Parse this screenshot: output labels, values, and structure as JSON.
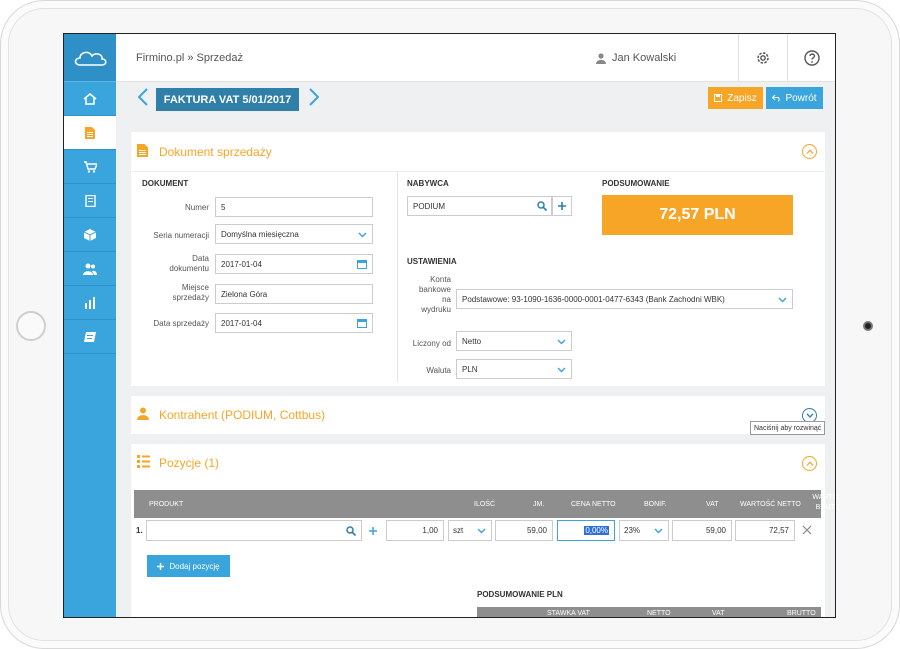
{
  "topbar": {
    "breadcrumb": "Firmino.pl » Sprzedaż",
    "user_name": "Jan Kowalski"
  },
  "titlebar": {
    "document_title": "FAKTURA VAT 5/01/2017",
    "save_label": "Zapisz",
    "back_label": "Powrót"
  },
  "sidebar": {
    "items": [
      {
        "icon": "home-icon"
      },
      {
        "icon": "document-icon",
        "active": true
      },
      {
        "icon": "cart-icon"
      },
      {
        "icon": "book-icon"
      },
      {
        "icon": "box-icon"
      },
      {
        "icon": "users-icon"
      },
      {
        "icon": "chart-icon"
      },
      {
        "icon": "notebook-icon"
      }
    ]
  },
  "document_section": {
    "title": "Dokument sprzedaży",
    "dokument": {
      "label": "DOKUMENT",
      "numer_label": "Numer",
      "numer_value": "5",
      "seria_label": "Seria numeracji",
      "seria_value": "Domyślna miesięczna",
      "data_dok_label_1": "Data",
      "data_dok_label_2": "dokumentu",
      "data_dok_value": "2017-01-04",
      "miejsce_label_1": "Miejsce",
      "miejsce_label_2": "sprzedaży",
      "miejsce_value": "Zielona Góra",
      "data_sprz_label": "Data sprzedaży",
      "data_sprz_value": "2017-01-04"
    },
    "nabywca": {
      "label": "NABYWCA",
      "value": "PODIUM"
    },
    "podsumowanie": {
      "label": "PODSUMOWANIE",
      "total": "72,57 PLN"
    },
    "ustawienia": {
      "label": "USTAWIENIA",
      "konta_label_1": "Konta",
      "konta_label_2": "bankowe",
      "konta_label_3": "na",
      "konta_label_4": "wydruku",
      "konta_value": "Podstawowe: 93-1090-1636-0000-0001-0477-6343 (Bank Zachodni WBK)",
      "liczony_label": "Liczony od",
      "liczony_value": "Netto",
      "waluta_label": "Waluta",
      "waluta_value": "PLN"
    }
  },
  "kontrahent_section": {
    "title": "Kontrahent (PODIUM, Cottbus)",
    "tooltip": "Naciśnij aby rozwinąć"
  },
  "pozycje_section": {
    "title": "Pozycje (1)",
    "headers": {
      "produkt": "PRODUKT",
      "ilosc": "ILOŚĆ",
      "jm": "JM.",
      "cena": "CENA NETTO",
      "bonif": "BONIF.",
      "vat": "VAT",
      "wartosc_netto": "WARTOŚĆ NETTO",
      "wartosc_brutto_1": "WARTOŚĆ",
      "wartosc_brutto_2": "BRUTTO"
    },
    "row": {
      "num": "1.",
      "ilosc": "1,00",
      "jm": "szt",
      "cena": "59,00",
      "bonif": "0,00%",
      "vat": "23%",
      "netto": "59,00",
      "brutto": "72,57"
    },
    "add_label": "Dodaj pozycję"
  },
  "summary": {
    "label": "PODSUMOWANIE PLN",
    "headers": [
      "STAWKA VAT",
      "NETTO",
      "VAT",
      "BRUTTO"
    ]
  },
  "colors": {
    "accent_blue": "#3aa4dc",
    "accent_orange": "#f7a527",
    "dark_blue": "#2f7fa9"
  }
}
